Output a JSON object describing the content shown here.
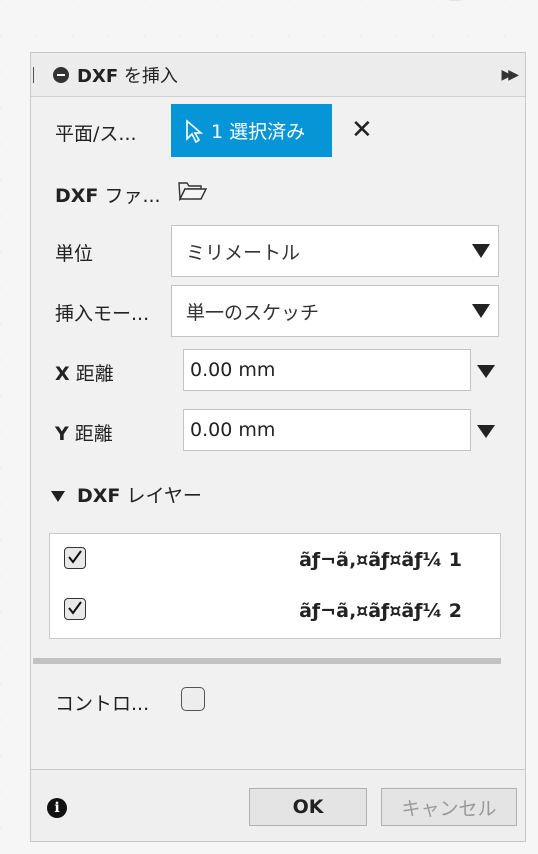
{
  "dialog": {
    "title_bold": "DXF",
    "title_rest": " を挿入"
  },
  "fields": {
    "plane_label": "平面/ス...",
    "plane_selection": "1 選択済み",
    "dxf_file_label_bold": "DXF",
    "dxf_file_label_rest": " ファ...",
    "unit_label": "単位",
    "unit_value": "ミリメートル",
    "insert_mode_label": "挿入モー...",
    "insert_mode_value": "単一のスケッチ",
    "x_label_bold": "X",
    "x_label_rest": " 距離",
    "x_value": "0.00 mm",
    "y_label_bold": "Y",
    "y_label_rest": " 距離",
    "y_value": "0.00 mm"
  },
  "layers": {
    "heading_bold": "DXF",
    "heading_rest": " レイヤー",
    "items": [
      {
        "name": "ãƒ¬ã‚¤ãƒ¤ãƒ¼ 1",
        "checked": true
      },
      {
        "name": "ãƒ¬ã‚¤ãƒ¤ãƒ¼ 2",
        "checked": true
      }
    ]
  },
  "control": {
    "label": "コントロ..."
  },
  "footer": {
    "info": "i",
    "ok": "OK",
    "cancel": "キャンセル"
  },
  "colors": {
    "accent": "#0696d7"
  }
}
